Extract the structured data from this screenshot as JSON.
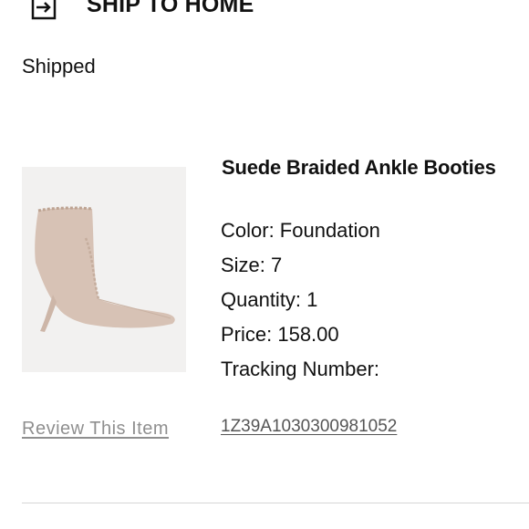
{
  "shipping": {
    "title": "SHIP TO HOME",
    "icon": "ship-to-home-icon",
    "status": "Shipped"
  },
  "product": {
    "name": "Suede Braided Ankle Booties",
    "image_icon": "boot-image",
    "color": "Color: Foundation",
    "size": "Size: 7",
    "quantity": "Quantity: 1",
    "price": "Price: 158.00",
    "tracking_label": "Tracking Number:",
    "tracking_number": "1Z39A1030300981052"
  },
  "actions": {
    "review_label": "Review This Item"
  },
  "colors": {
    "text": "#111111",
    "muted_link": "#8f8f8f",
    "tracking_link": "#555555",
    "image_bg": "#f2f1f0",
    "boot": "#d7c2b5"
  }
}
